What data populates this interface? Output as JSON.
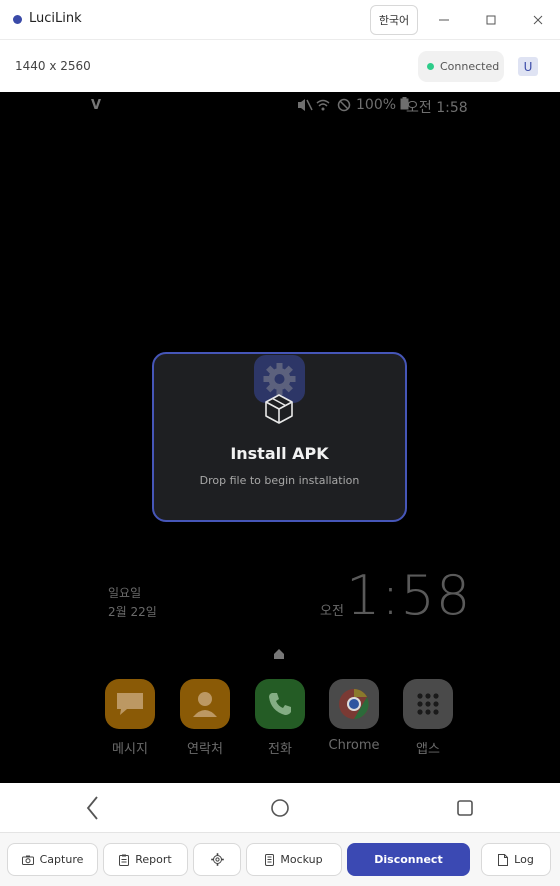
{
  "window": {
    "title": "LuciLink",
    "lang_label": "한국어",
    "brand_color": "#3a4aa8"
  },
  "device": {
    "resolution": "1440 x 2560",
    "status": "Connected",
    "status_color": "#2ecc8a",
    "avatar_letter": "U"
  },
  "phone": {
    "status_bar": {
      "left_icon": "V",
      "battery": "100%",
      "time": "오전 1:58"
    },
    "clock": {
      "day": "일요일",
      "date": "2월 22일",
      "ampm": "오전",
      "time": "1:58"
    },
    "dock": [
      {
        "label": "메시지",
        "color": "#8a5a06",
        "icon": "message-icon"
      },
      {
        "label": "연락처",
        "color": "#8a5a06",
        "icon": "contact-icon"
      },
      {
        "label": "전화",
        "color": "#245c25",
        "icon": "phone-icon"
      },
      {
        "label": "Chrome",
        "color": "#4a4a4a",
        "icon": "chrome-icon"
      },
      {
        "label": "앱스",
        "color": "#4a4a4a",
        "icon": "apps-grid-icon"
      }
    ]
  },
  "overlay": {
    "title": "Install APK",
    "subtitle": "Drop file to begin installation"
  },
  "toolbar": {
    "capture": "Capture",
    "report": "Report",
    "mockup": "Mockup",
    "disconnect": "Disconnect",
    "log": "Log"
  }
}
